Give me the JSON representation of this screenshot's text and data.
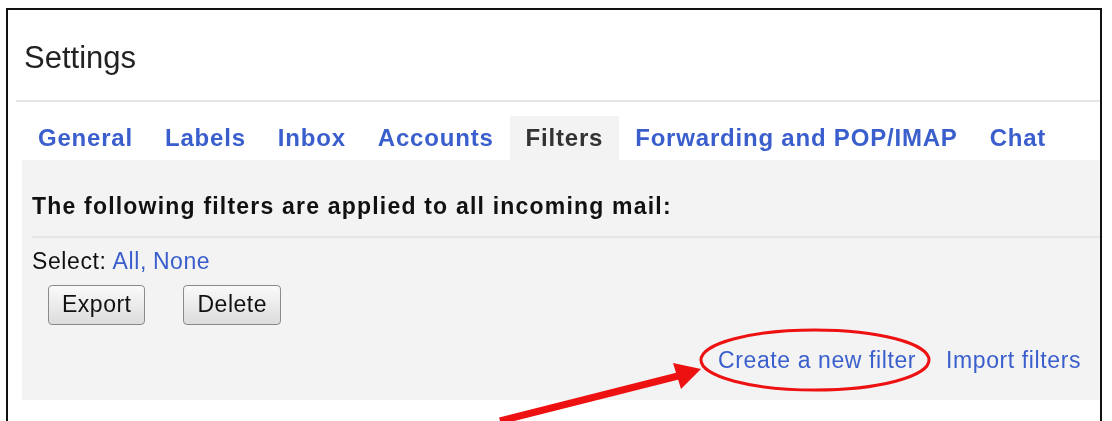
{
  "window": {
    "title": "Settings"
  },
  "tabs": [
    {
      "label": "General",
      "selected": false
    },
    {
      "label": "Labels",
      "selected": false
    },
    {
      "label": "Inbox",
      "selected": false
    },
    {
      "label": "Accounts",
      "selected": false
    },
    {
      "label": "Filters",
      "selected": true
    },
    {
      "label": "Forwarding and POP/IMAP",
      "selected": false
    },
    {
      "label": "Chat",
      "selected": false
    }
  ],
  "filters": {
    "heading": "The following filters are applied to all incoming mail:",
    "select_label": "Select:",
    "select_links": [
      "All,",
      "None"
    ],
    "buttons": [
      "Export",
      "Delete"
    ],
    "actions": [
      "Create a new filter",
      "Import filters"
    ]
  }
}
